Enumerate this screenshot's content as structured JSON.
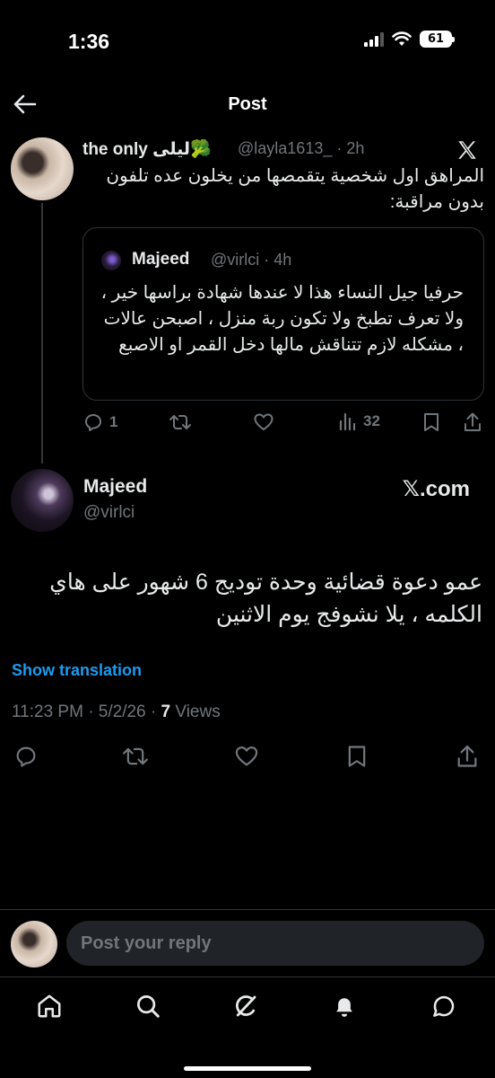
{
  "status_bar": {
    "time": "1:36",
    "battery": "61"
  },
  "header": {
    "title": "Post"
  },
  "tweet1": {
    "display_name": "the only ليلى",
    "handle_time": "@layla1613_ · 2h",
    "text": "المراهق اول شخصية يتقمصها من يخلون عده تلفون بدون مراقبة:",
    "quote": {
      "name": "Majeed",
      "handle_time": "@virlci · 4h",
      "text": "حرفيا جيل النساء هذا لا عندها شهادة براسها خير ، ولا تعرف تطبخ ولا تكون ربة منزل ، اصبحن عالات ، مشكله لازم تتناقش مالها دخل القمر او الاصبع"
    },
    "actions": {
      "replies": "1",
      "views": "32"
    }
  },
  "tweet2": {
    "name": "Majeed",
    "handle": "@virlci",
    "watermark": "𝕏.com",
    "text": "عمو دعوة قضائية وحدة توديج 6 شهور على هاي الكلمه ، يلا نشوفج يوم الاثنين",
    "show_translation": "Show translation",
    "meta_prefix": "11:23 PM · 5/2/26 · ",
    "views_count": "7",
    "views_label": " Views"
  },
  "reply": {
    "placeholder": "Post your reply"
  },
  "icons": {
    "back": "back-arrow-icon",
    "x": "x-logo-icon",
    "reply": "reply-icon",
    "repost": "repost-icon",
    "like": "heart-icon",
    "views": "analytics-icon",
    "bookmark": "bookmark-icon",
    "share": "share-icon",
    "nav": [
      "home-icon",
      "search-icon",
      "grok-icon",
      "notifications-icon",
      "messages-icon"
    ]
  },
  "colors": {
    "accent": "#1d9bf0",
    "background": "#000000",
    "muted": "#71767b"
  }
}
